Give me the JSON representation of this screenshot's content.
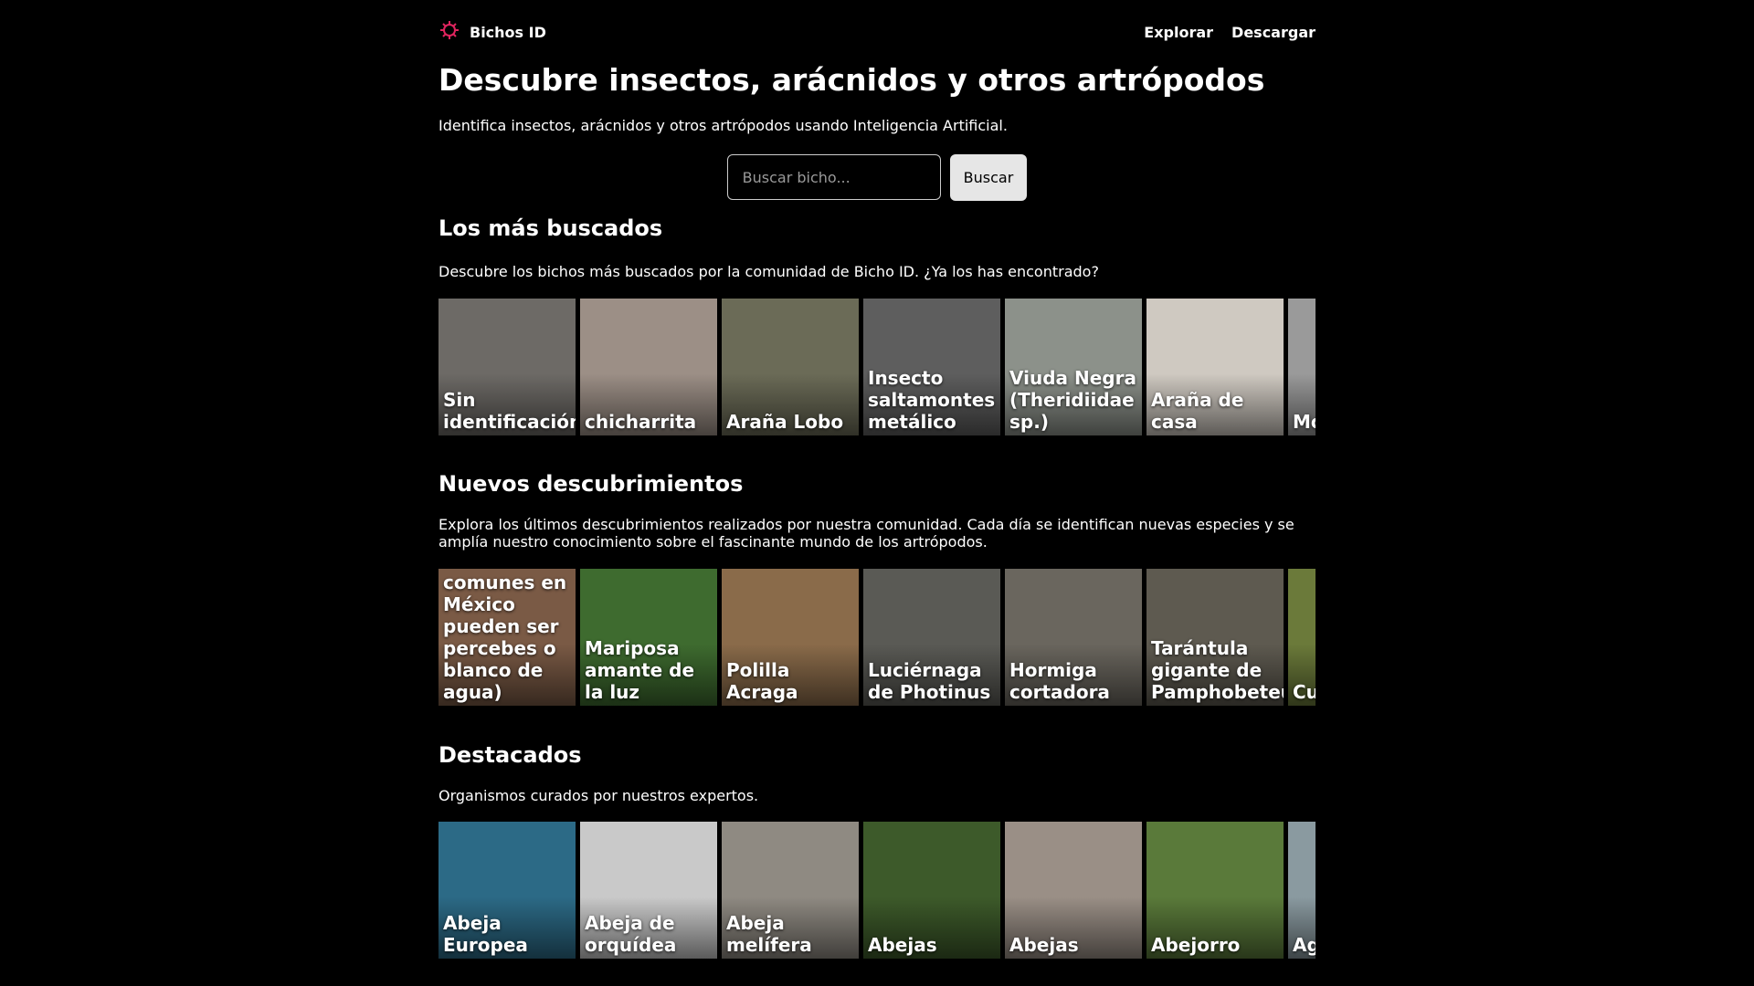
{
  "header": {
    "brand": "Bichos ID",
    "nav": [
      "Explorar",
      "Descargar"
    ]
  },
  "hero": {
    "title": "Descubre insectos, arácnidos y otros artrópodos",
    "subtitle": "Identifica insectos, arácnidos y otros artrópodos usando Inteligencia Artificial.",
    "search_placeholder": "Buscar bicho...",
    "search_button": "Buscar"
  },
  "sections": [
    {
      "title": "Los más buscados",
      "description": "Descubre los bichos más buscados por la comunidad de Bicho ID. ¿Ya los has encontrado?",
      "items": [
        {
          "label": "Sin identificación",
          "bg": "#6d6a66"
        },
        {
          "label": "chicharrita",
          "bg": "#9c8f86"
        },
        {
          "label": "Araña Lobo",
          "bg": "#6b6b57"
        },
        {
          "label": "Insecto saltamontes metálico",
          "bg": "#5e5e5e"
        },
        {
          "label": "Viuda Negra (Theridiidae sp.)",
          "bg": "#8c918a"
        },
        {
          "label": "Araña de casa",
          "bg": "#cfc9c1"
        },
        {
          "label": "Mo (C sp",
          "bg": "#9a9a9a"
        }
      ]
    },
    {
      "title": "Nuevos descubrimientos",
      "description": "Explora los últimos descubrimientos realizados por nuestra comunidad. Cada día se identifican nuevas especies y se amplía nuestro conocimiento sobre el fascinante mundo de los artrópodos.",
      "items": [
        {
          "label": "comunes en México pueden ser percebes o blanco de agua)",
          "bg": "#7a5a45"
        },
        {
          "label": "Mariposa amante de la luz",
          "bg": "#3e6b2f"
        },
        {
          "label": "Polilla Acraga",
          "bg": "#8a6b4a"
        },
        {
          "label": "Luciérnaga de Photinus",
          "bg": "#5a5a55"
        },
        {
          "label": "Hormiga cortadora",
          "bg": "#6a665e"
        },
        {
          "label": "Tarántula gigante de Pamphobeteus",
          "bg": "#5e5a50"
        },
        {
          "label": "Cu de (C",
          "bg": "#6b7a3a"
        }
      ]
    },
    {
      "title": "Destacados",
      "description": "Organismos curados por nuestros expertos.",
      "items": [
        {
          "label": "Abeja Europea",
          "bg": "#2c6a86"
        },
        {
          "label": "Abeja de orquídea",
          "bg": "#c9c9c9"
        },
        {
          "label": "Abeja melífera",
          "bg": "#8f8a82"
        },
        {
          "label": "Abejas",
          "bg": "#3d5a2a"
        },
        {
          "label": "Abejas",
          "bg": "#9a8f86"
        },
        {
          "label": "Abejorro",
          "bg": "#5a7a3a"
        },
        {
          "label": "Ag ce",
          "bg": "#8a9aa0"
        }
      ]
    }
  ]
}
